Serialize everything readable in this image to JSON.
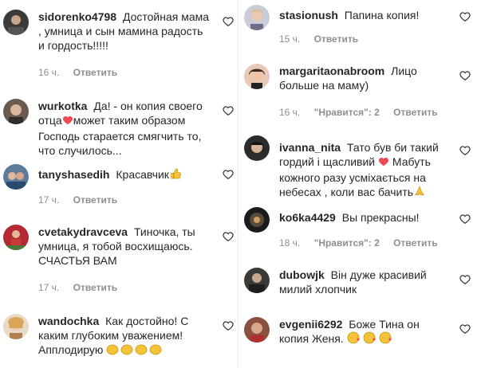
{
  "left": [
    {
      "user": "sidorenko4798",
      "lines": [
        "Достойная мама",
        ", умница и сын мамина радость",
        "и гордость!!!!!"
      ],
      "time": "16 ч.",
      "reply": "Ответить",
      "likes": ""
    },
    {
      "user": "wurkotka",
      "lines": [
        "Да! - он копия своего",
        "отца",
        "может таким образом",
        "Господь старается смягчить то,",
        "что случилось..."
      ],
      "time": "",
      "reply": "",
      "likes": ""
    },
    {
      "user": "tanyshasedih",
      "lines": [
        "Красавчик"
      ],
      "time": "17 ч.",
      "reply": "Ответить",
      "likes": ""
    },
    {
      "user": "cvetakydravceva",
      "lines": [
        "Тиночка, ты",
        "умница, я тобой восхищаюсь.",
        "СЧАСТЬЯ ВАМ"
      ],
      "time": "17 ч.",
      "reply": "Ответить",
      "likes": ""
    },
    {
      "user": "wandochka",
      "lines": [
        "Как достойно! С",
        "каким глубоким уважением!",
        "Апплодирую"
      ],
      "time": "",
      "reply": "",
      "likes": ""
    }
  ],
  "right": [
    {
      "user": "stasionush",
      "lines": [
        "Папина копия!"
      ],
      "time": "15 ч.",
      "reply": "Ответить",
      "likes": ""
    },
    {
      "user": "margaritaonabroom",
      "lines": [
        "Лицо",
        "больше на маму)"
      ],
      "time": "16 ч.",
      "reply": "Ответить",
      "likes": "\"Нравится\": 2"
    },
    {
      "user": "ivanna_nita",
      "lines": [
        "Тато був би такий",
        "гордий і щасливий",
        "Мабуть",
        "кожного разу усміхається на",
        "небесах , коли вас бачить"
      ],
      "time": "",
      "reply": "",
      "likes": ""
    },
    {
      "user": "ko6ka4429",
      "lines": [
        "Вы прекрасны!"
      ],
      "time": "18 ч.",
      "reply": "Ответить",
      "likes": "\"Нравится\": 2"
    },
    {
      "user": "dubowjk",
      "lines": [
        "Він дуже красивий",
        "милий хлопчик"
      ],
      "time": "",
      "reply": "",
      "likes": ""
    },
    {
      "user": "evgenii6292",
      "lines": [
        "Боже Тина он",
        "копия Женя."
      ],
      "time": "",
      "reply": "",
      "likes": ""
    }
  ],
  "colors": {
    "text": "#262626",
    "meta": "#8e8e8e",
    "heart_stroke": "#262626",
    "emoji_heart": "#ed4956",
    "emoji_yellow": "#f5c33b"
  }
}
